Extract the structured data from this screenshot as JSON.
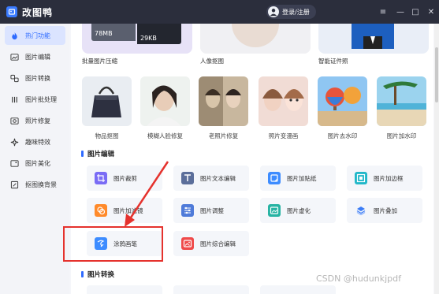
{
  "app": {
    "title": "改图鸭",
    "login_label": "登录/注册"
  },
  "window_controls": [
    "≡",
    "—",
    "□",
    "✕"
  ],
  "sidebar": {
    "items": [
      {
        "label": "热门功能",
        "icon": "flame-icon",
        "active": true
      },
      {
        "label": "图片编辑",
        "icon": "image-edit-icon"
      },
      {
        "label": "图片转换",
        "icon": "convert-icon"
      },
      {
        "label": "图片批处理",
        "icon": "batch-icon"
      },
      {
        "label": "照片修复",
        "icon": "repair-icon"
      },
      {
        "label": "趣味特效",
        "icon": "sparkle-icon"
      },
      {
        "label": "图片美化",
        "icon": "beautify-icon"
      },
      {
        "label": "抠图换背景",
        "icon": "cutout-icon"
      }
    ]
  },
  "top_cards": {
    "labels": [
      "批量图片压缩",
      "人像抠图",
      "智能证件照"
    ],
    "size_a": "78MB",
    "size_b": "29KB"
  },
  "photo_tiles": [
    "物品抠图",
    "模糊人脸修复",
    "老照片修复",
    "照片变漫画",
    "图片去水印",
    "图片加水印"
  ],
  "sections": {
    "edit": "图片编辑",
    "convert": "图片转换"
  },
  "tools": [
    {
      "label": "图片裁剪",
      "icon": "crop-icon",
      "color": "#7a6cf5"
    },
    {
      "label": "图片文本编辑",
      "icon": "text-icon",
      "color": "#5b6e9a"
    },
    {
      "label": "图片加贴纸",
      "icon": "sticker-icon",
      "color": "#3d8cff"
    },
    {
      "label": "图片加边框",
      "icon": "frame-icon",
      "color": "#22b8c9"
    },
    {
      "label": "图片加滤镜",
      "icon": "filter-icon",
      "color": "#ff8a2a"
    },
    {
      "label": "图片调整",
      "icon": "adjust-icon",
      "color": "#4f7bd9"
    },
    {
      "label": "图片虚化",
      "icon": "blur-icon",
      "color": "#27b3a3"
    },
    {
      "label": "图片叠加",
      "icon": "layers-icon",
      "color": "#3b7cf6"
    },
    {
      "label": "涂鸦画笔",
      "icon": "brush-icon",
      "color": "#3d8cff"
    },
    {
      "label": "图片综合编辑",
      "icon": "combo-edit-icon",
      "color": "#ef4a4a"
    }
  ],
  "watermark": "CSDN @hudunkjpdf",
  "colors": {
    "accent": "#2f6bff",
    "titlebar": "#2b2e3c",
    "highlight": "#e5322d"
  }
}
